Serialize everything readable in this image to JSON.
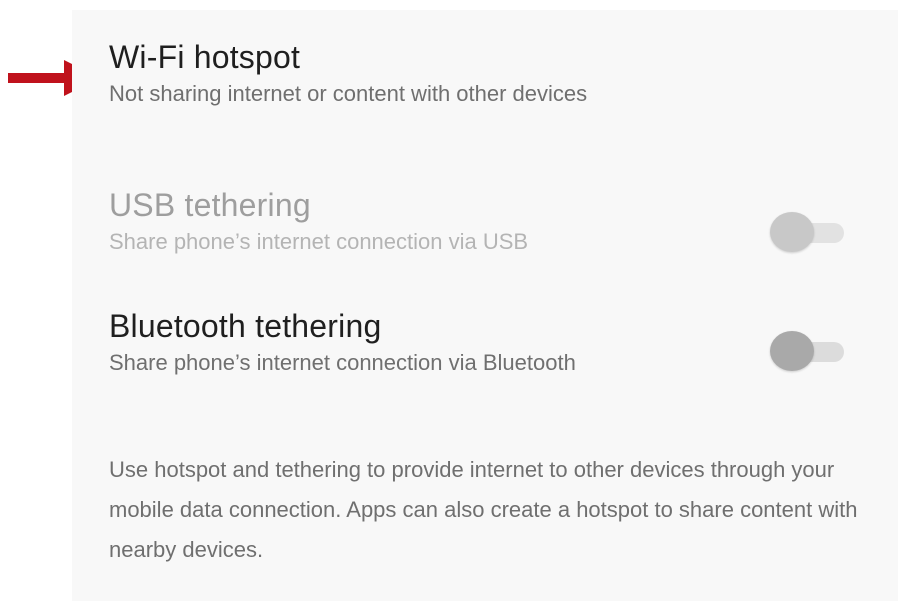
{
  "settings": {
    "wifi_hotspot": {
      "title": "Wi-Fi hotspot",
      "summary": "Not sharing internet or content with other devices"
    },
    "usb_tethering": {
      "title": "USB tethering",
      "summary": "Share phone’s internet connection via USB",
      "enabled": false,
      "checked": false
    },
    "bluetooth_tethering": {
      "title": "Bluetooth tethering",
      "summary": "Share phone’s internet connection via Bluetooth",
      "enabled": true,
      "checked": false
    },
    "footer_text": "Use hotspot and tethering to provide internet to other devices through your mobile data connection. Apps can also create a hotspot to share content with nearby devices."
  },
  "annotation": {
    "arrow_color": "#c0121c",
    "arrow_icon": "arrow-right-icon"
  }
}
